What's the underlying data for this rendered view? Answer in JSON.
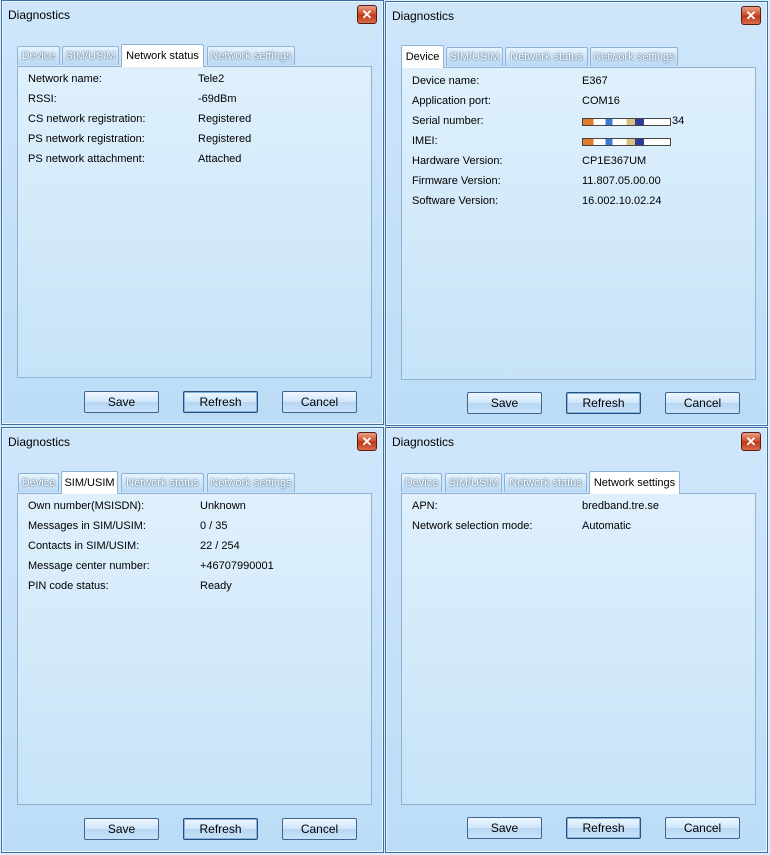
{
  "dialogs": [
    {
      "title": "Diagnostics",
      "tabs": [
        "Device",
        "SIM/USIM",
        "Network status",
        "Network settings"
      ],
      "active_tab": "Network status",
      "rows": [
        {
          "label": "Network name:",
          "value": "Tele2"
        },
        {
          "label": "RSSI:",
          "value": "-69dBm"
        },
        {
          "label": "CS network registration:",
          "value": "Registered"
        },
        {
          "label": "PS network registration:",
          "value": "Registered"
        },
        {
          "label": "PS network attachment:",
          "value": "Attached"
        }
      ],
      "buttons": {
        "save": "Save",
        "refresh": "Refresh",
        "cancel": "Cancel"
      }
    },
    {
      "title": "Diagnostics",
      "tabs": [
        "Device",
        "SIM/USIM",
        "Network status",
        "Network settings"
      ],
      "active_tab": "Device",
      "rows": [
        {
          "label": "Device name:",
          "value": "E367"
        },
        {
          "label": "Application port:",
          "value": "COM16"
        },
        {
          "label": "Serial number:",
          "value": "34"
        },
        {
          "label": "IMEI:",
          "value": ""
        },
        {
          "label": "Hardware Version:",
          "value": "CP1E367UM"
        },
        {
          "label": "Firmware Version:",
          "value": "11.807.05.00.00"
        },
        {
          "label": "Software Version:",
          "value": "16.002.10.02.24"
        }
      ],
      "buttons": {
        "save": "Save",
        "refresh": "Refresh",
        "cancel": "Cancel"
      }
    },
    {
      "title": "Diagnostics",
      "tabs": [
        "Device",
        "SIM/USIM",
        "Network status",
        "Network settings"
      ],
      "active_tab": "SIM/USIM",
      "rows": [
        {
          "label": "Own number(MSISDN):",
          "value": "Unknown"
        },
        {
          "label": "Messages in SIM/USIM:",
          "value": "0 / 35"
        },
        {
          "label": "Contacts in SIM/USIM:",
          "value": "22 / 254"
        },
        {
          "label": "Message center number:",
          "value": "+46707990001"
        },
        {
          "label": "PIN code status:",
          "value": "Ready"
        }
      ],
      "buttons": {
        "save": "Save",
        "refresh": "Refresh",
        "cancel": "Cancel"
      }
    },
    {
      "title": "Diagnostics",
      "tabs": [
        "Device",
        "SIM/USIM",
        "Network status",
        "Network settings"
      ],
      "active_tab": "Network settings",
      "rows": [
        {
          "label": "APN:",
          "value": "bredband.tre.se"
        },
        {
          "label": "Network selection mode:",
          "value": "Automatic"
        }
      ],
      "buttons": {
        "save": "Save",
        "refresh": "Refresh",
        "cancel": "Cancel"
      }
    }
  ],
  "icons": {
    "close": "close-x-icon"
  },
  "colors": {
    "close_button": "#c0381a",
    "panel_border": "#8fb3d4"
  }
}
